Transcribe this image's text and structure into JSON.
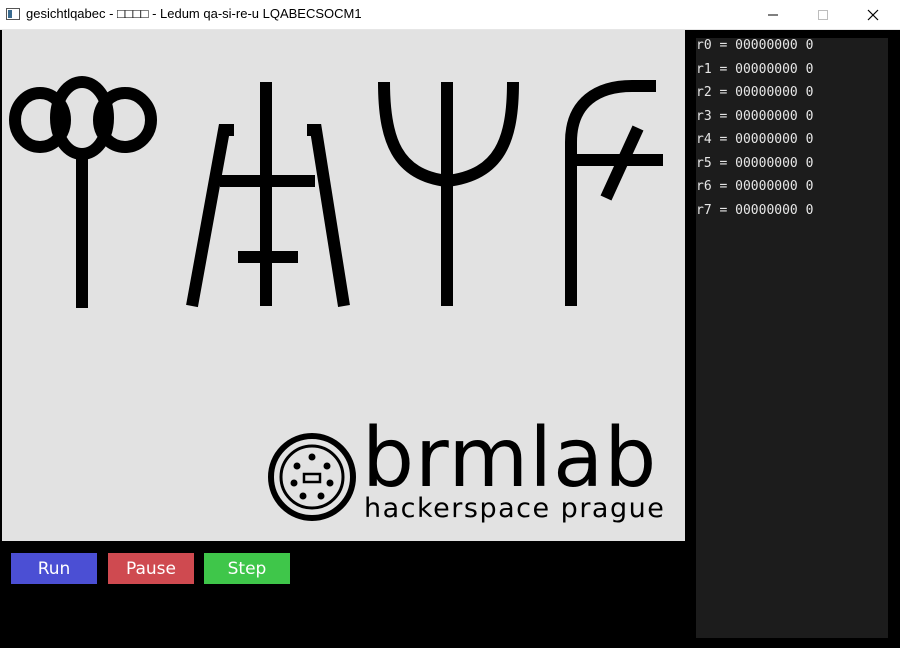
{
  "window": {
    "title": "gesichtlqabec - □□□□ - Ledum qa-si-re-u LQABECSOCM1"
  },
  "display": {
    "glyph_count": 4,
    "logo": {
      "name": "brmlab",
      "subtitle": "hackerspace prague"
    }
  },
  "controls": {
    "run_label": "Run",
    "pause_label": "Pause",
    "step_label": "Step"
  },
  "registers": [
    {
      "label": "r0 = 00000000 0"
    },
    {
      "label": "r1 = 00000000 0"
    },
    {
      "label": "r2 = 00000000 0"
    },
    {
      "label": "r3 = 00000000 0"
    },
    {
      "label": "r4 = 00000000 0"
    },
    {
      "label": "r5 = 00000000 0"
    },
    {
      "label": "r6 = 00000000 0"
    },
    {
      "label": "r7 = 00000000 0"
    }
  ],
  "colors": {
    "run": "#4b4fd4",
    "pause": "#cf4a50",
    "step": "#3fc64a",
    "display_bg": "#e2e2e2",
    "register_bg": "#1c1c1c"
  }
}
